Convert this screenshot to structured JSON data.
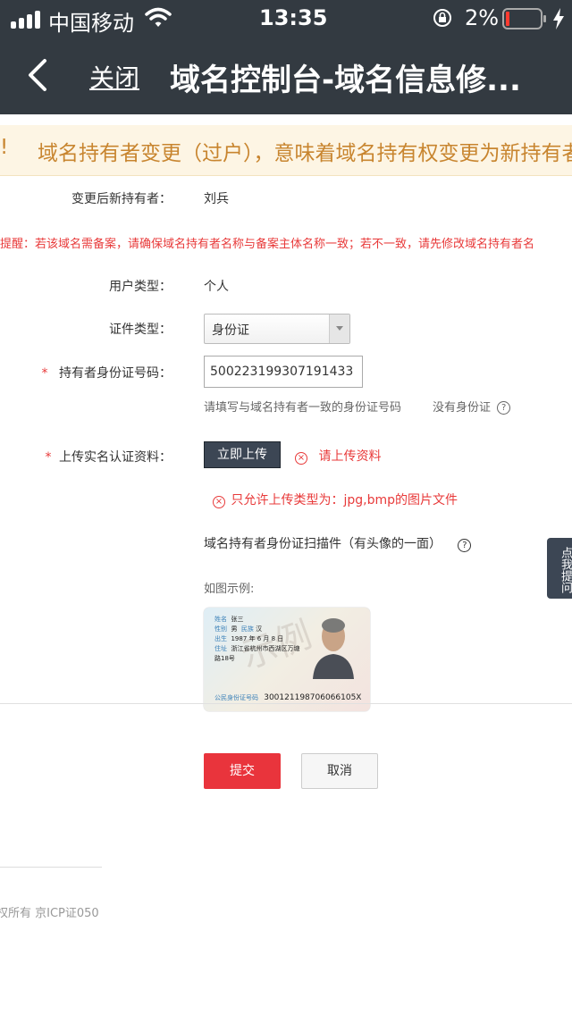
{
  "status": {
    "carrier": "中国移动",
    "time": "13:35",
    "battery": "2%"
  },
  "nav": {
    "close_label": "关闭",
    "title": "域名控制台-域名信息修..."
  },
  "notice": {
    "prefix": "!",
    "text": "域名持有者变更（过户），意味着域名持有权变更为新持有者"
  },
  "form": {
    "new_holder_label": "变更后新持有者：",
    "new_holder_value": "刘兵",
    "reminder": "提醒：若该域名需备案，请确保域名持有者名称与备案主体名称一致；若不一致，请先修改域名持有者名",
    "user_type_label": "用户类型：",
    "user_type_value": "个人",
    "cert_type_label": "证件类型：",
    "cert_type_value": "身份证",
    "id_label": "持有者身份证号码：",
    "id_value": "500223199307191433",
    "id_hint": "请填写与域名持有者一致的身份证号码",
    "no_id_link": "没有身份证",
    "upload_label": "上传实名认证资料：",
    "upload_button": "立即上传",
    "upload_error": "请上传资料",
    "type_error": "只允许上传类型为：jpg,bmp的图片文件",
    "scan_title": "域名持有者身份证扫描件（有头像的一面）",
    "example_label": "如图示例:",
    "required_mark": "*"
  },
  "id_card": {
    "name": "张三",
    "gender": "男",
    "ethnicity": "汉",
    "birth": "1987 年 6 月 8 日",
    "address": "浙江省杭州市西湖区万塘路18号",
    "number": "300121198706066105X",
    "field_name": "姓名",
    "field_gender": "性别",
    "field_ethnicity": "民族",
    "field_birth": "出生",
    "field_address": "住址",
    "field_number": "公民身份证号码",
    "watermark": "示例"
  },
  "actions": {
    "submit": "提交",
    "cancel": "取消"
  },
  "side_tab": "点我提问",
  "footer": {
    "text": "权所有 京ICP证050"
  },
  "colors": {
    "nav_bg": "#333a41",
    "notice_bg": "#fdf5e4",
    "notice_text": "#c8852f",
    "error": "#e83a3a",
    "submit_bg": "#e9343c",
    "upload_bg": "#3c4654"
  }
}
